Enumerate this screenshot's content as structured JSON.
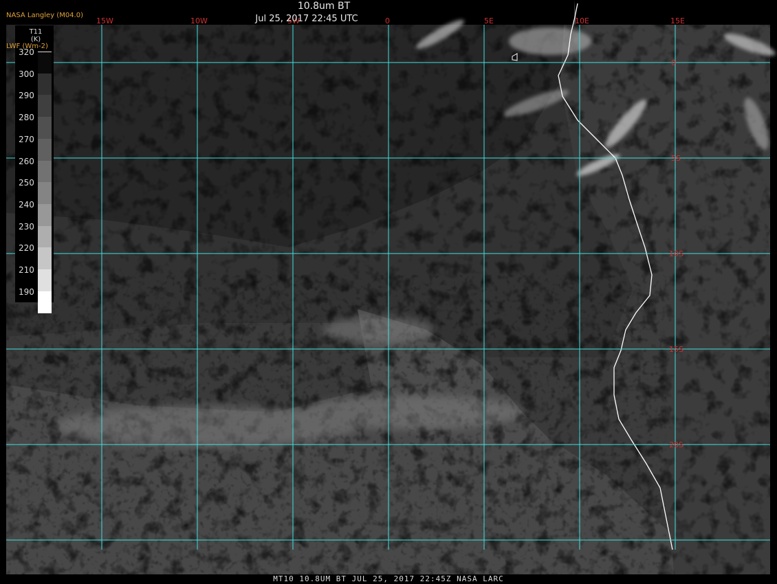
{
  "header": {
    "title": "10.8um BT",
    "date": "Jul 25, 2017 22:45 UTC",
    "credit": "NASA Langley (M04.0)"
  },
  "legend": {
    "variable": "T11",
    "unit": "(K)",
    "secondary_unit": "LWF (Wm-2)",
    "ticks": [
      "320",
      "300",
      "290",
      "280",
      "270",
      "260",
      "250",
      "240",
      "230",
      "220",
      "210",
      "190"
    ],
    "colors": [
      "#0a0a0a",
      "#303030",
      "#3f3f3f",
      "#505050",
      "#606060",
      "#727272",
      "#848484",
      "#989898",
      "#aeaeae",
      "#c6c6c6",
      "#e0e0e0",
      "#ffffff"
    ]
  },
  "grid": {
    "lon_labels": [
      "15W",
      "10W",
      "5W",
      "0",
      "5E",
      "10E",
      "15E"
    ],
    "lat_labels": [
      "0",
      "5S",
      "10S",
      "15S",
      "20S"
    ],
    "grid_color": "#40e0e0",
    "label_color": "#d03030"
  },
  "footer": {
    "text": "MT10  10.8UM BT   JUL 25, 2017 22:45Z  NASA LARC"
  }
}
